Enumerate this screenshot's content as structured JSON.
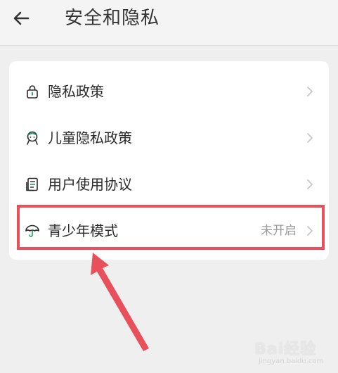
{
  "header": {
    "back_icon": "arrow-left-icon",
    "title": "安全和隐私"
  },
  "menu": {
    "items": [
      {
        "icon": "lock-icon",
        "label": "隐私政策",
        "value": ""
      },
      {
        "icon": "child-face-icon",
        "label": "儿童隐私政策",
        "value": ""
      },
      {
        "icon": "document-icon",
        "label": "用户使用协议",
        "value": ""
      },
      {
        "icon": "umbrella-icon",
        "label": "青少年模式",
        "value": "未开启"
      }
    ]
  },
  "annotation": {
    "highlight_color": "#e8505b"
  },
  "watermark": {
    "text": "Bai经验",
    "sub": "jingyan.baidu.com"
  },
  "colors": {
    "accent": "#1e9e6a",
    "background": "#efefef",
    "card": "#ffffff"
  }
}
